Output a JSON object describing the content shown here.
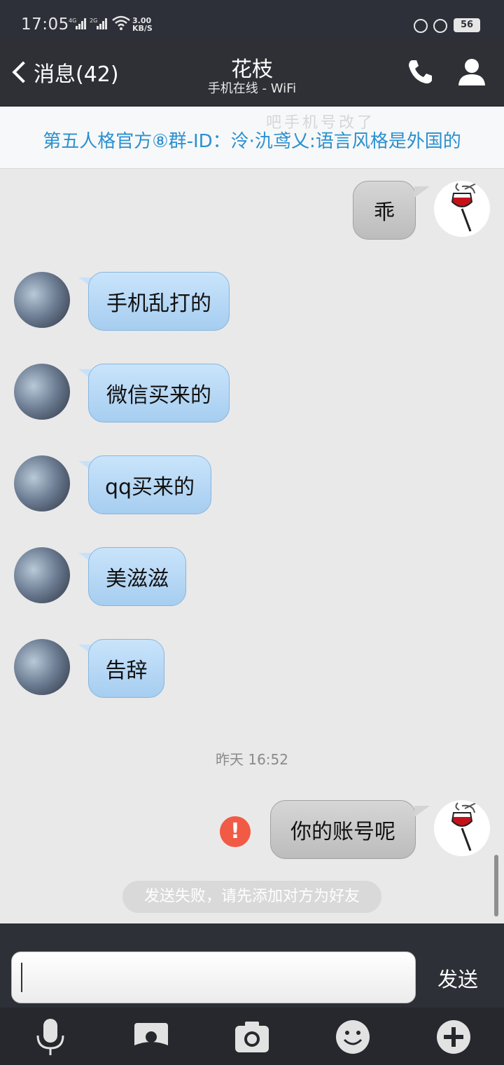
{
  "status_bar": {
    "time": "17:05",
    "signal1": "4G",
    "signal2": "2G",
    "speed_value": "3.00",
    "speed_unit": "KB/S",
    "battery": "56"
  },
  "header": {
    "back_label": "消息(42)",
    "contact_name": "花枝",
    "contact_status": "手机在线 - WiFi"
  },
  "notice": {
    "watermark": "吧手机号改了",
    "text": "第五人格官方⑧群-ID：泠·氿鸢乂:语言风格是外国的"
  },
  "messages": [
    {
      "side": "right",
      "text": "乖"
    },
    {
      "side": "left",
      "text": "手机乱打的"
    },
    {
      "side": "left",
      "text": "微信买来的"
    },
    {
      "side": "left",
      "text": "qq买来的"
    },
    {
      "side": "left",
      "text": "美滋滋"
    },
    {
      "side": "left",
      "text": "告辞"
    }
  ],
  "timestamp": "昨天 16:52",
  "failed_message": {
    "text": "你的账号呢",
    "error_icon": "!",
    "notice": "发送失败，请先添加对方为好友"
  },
  "input": {
    "value": "",
    "send_label": "发送"
  },
  "toolbar": {
    "icons": [
      "microphone-icon",
      "image-icon",
      "camera-icon",
      "emoji-icon",
      "plus-icon"
    ]
  },
  "colors": {
    "header_bg": "#2e3036",
    "notice_text": "#2a90d0",
    "bubble_left": "#b6d8f5",
    "bubble_right": "#c9c9c9",
    "error": "#f15a44"
  }
}
